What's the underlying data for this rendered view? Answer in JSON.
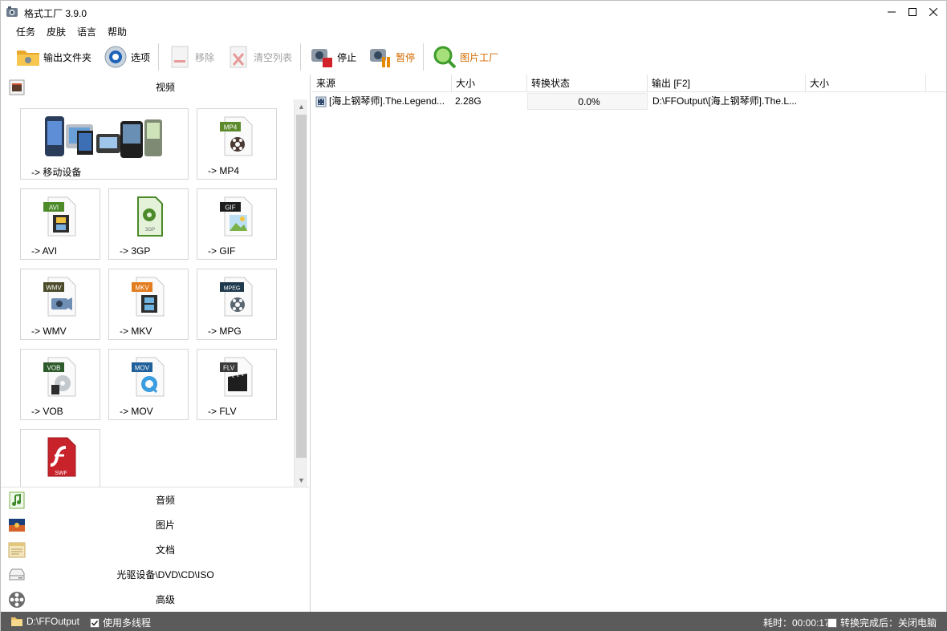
{
  "window": {
    "title": "格式工厂 3.9.0"
  },
  "menu": [
    "任务",
    "皮肤",
    "语言",
    "帮助"
  ],
  "toolbar": {
    "output_folder": "输出文件夹",
    "options": "选项",
    "remove": "移除",
    "clear_list": "清空列表",
    "stop": "停止",
    "pause": "暂停",
    "picture_factory": "图片工厂"
  },
  "video_category": "视频",
  "tiles": [
    {
      "label": "-> 移动设备",
      "badge": ""
    },
    {
      "label": "-> MP4",
      "badge": "MP4"
    },
    {
      "label": "-> AVI",
      "badge": "AVI"
    },
    {
      "label": "-> 3GP",
      "badge": "3GP"
    },
    {
      "label": "-> GIF",
      "badge": "GIF"
    },
    {
      "label": "-> WMV",
      "badge": "WMV"
    },
    {
      "label": "-> MKV",
      "badge": "MKV"
    },
    {
      "label": "-> MPG",
      "badge": "MPEG"
    },
    {
      "label": "-> VOB",
      "badge": "VOB"
    },
    {
      "label": "-> MOV",
      "badge": "MOV"
    },
    {
      "label": "-> FLV",
      "badge": "FLV"
    },
    {
      "label": "",
      "badge": "SWF"
    }
  ],
  "categories": [
    "音频",
    "图片",
    "文档",
    "光驱设备\\DVD\\CD\\ISO",
    "高级"
  ],
  "table": {
    "headers": [
      "来源",
      "大小",
      "转换状态",
      "输出 [F2]",
      "大小"
    ],
    "rows": [
      {
        "source": "[海上钢琴师].The.Legend...",
        "size": "2.28G",
        "status": "0.0%",
        "output": "D:\\FFOutput\\[海上钢琴师].The.L...",
        "out_size": ""
      }
    ]
  },
  "status": {
    "folder": "D:\\FFOutput",
    "multithread": "使用多线程",
    "elapsed": "耗时：00:00:17",
    "after_done": "转换完成后：关闭电脑"
  }
}
